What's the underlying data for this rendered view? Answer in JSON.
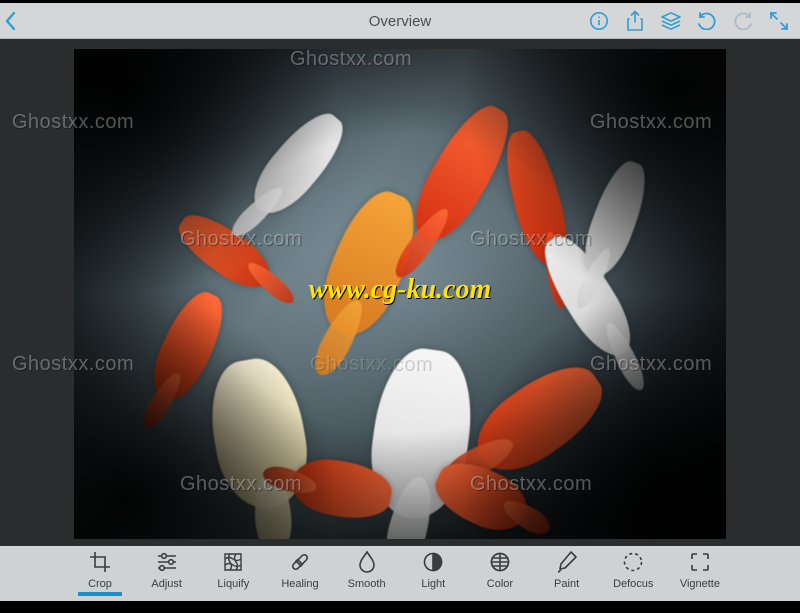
{
  "header": {
    "title": "Overview"
  },
  "tools": [
    {
      "id": "crop",
      "label": "Crop"
    },
    {
      "id": "adjust",
      "label": "Adjust"
    },
    {
      "id": "liquify",
      "label": "Liquify"
    },
    {
      "id": "healing",
      "label": "Healing"
    },
    {
      "id": "smooth",
      "label": "Smooth"
    },
    {
      "id": "light",
      "label": "Light"
    },
    {
      "id": "color",
      "label": "Color"
    },
    {
      "id": "paint",
      "label": "Paint"
    },
    {
      "id": "defocus",
      "label": "Defocus"
    },
    {
      "id": "vignette",
      "label": "Vignette"
    }
  ],
  "selectedTool": "crop",
  "watermarks": {
    "ghost": "Ghostxx.com",
    "center": "www.cg-ku.com"
  },
  "colors": {
    "accent": "#2f9ed3",
    "toolbar": "#cfd1d3"
  }
}
